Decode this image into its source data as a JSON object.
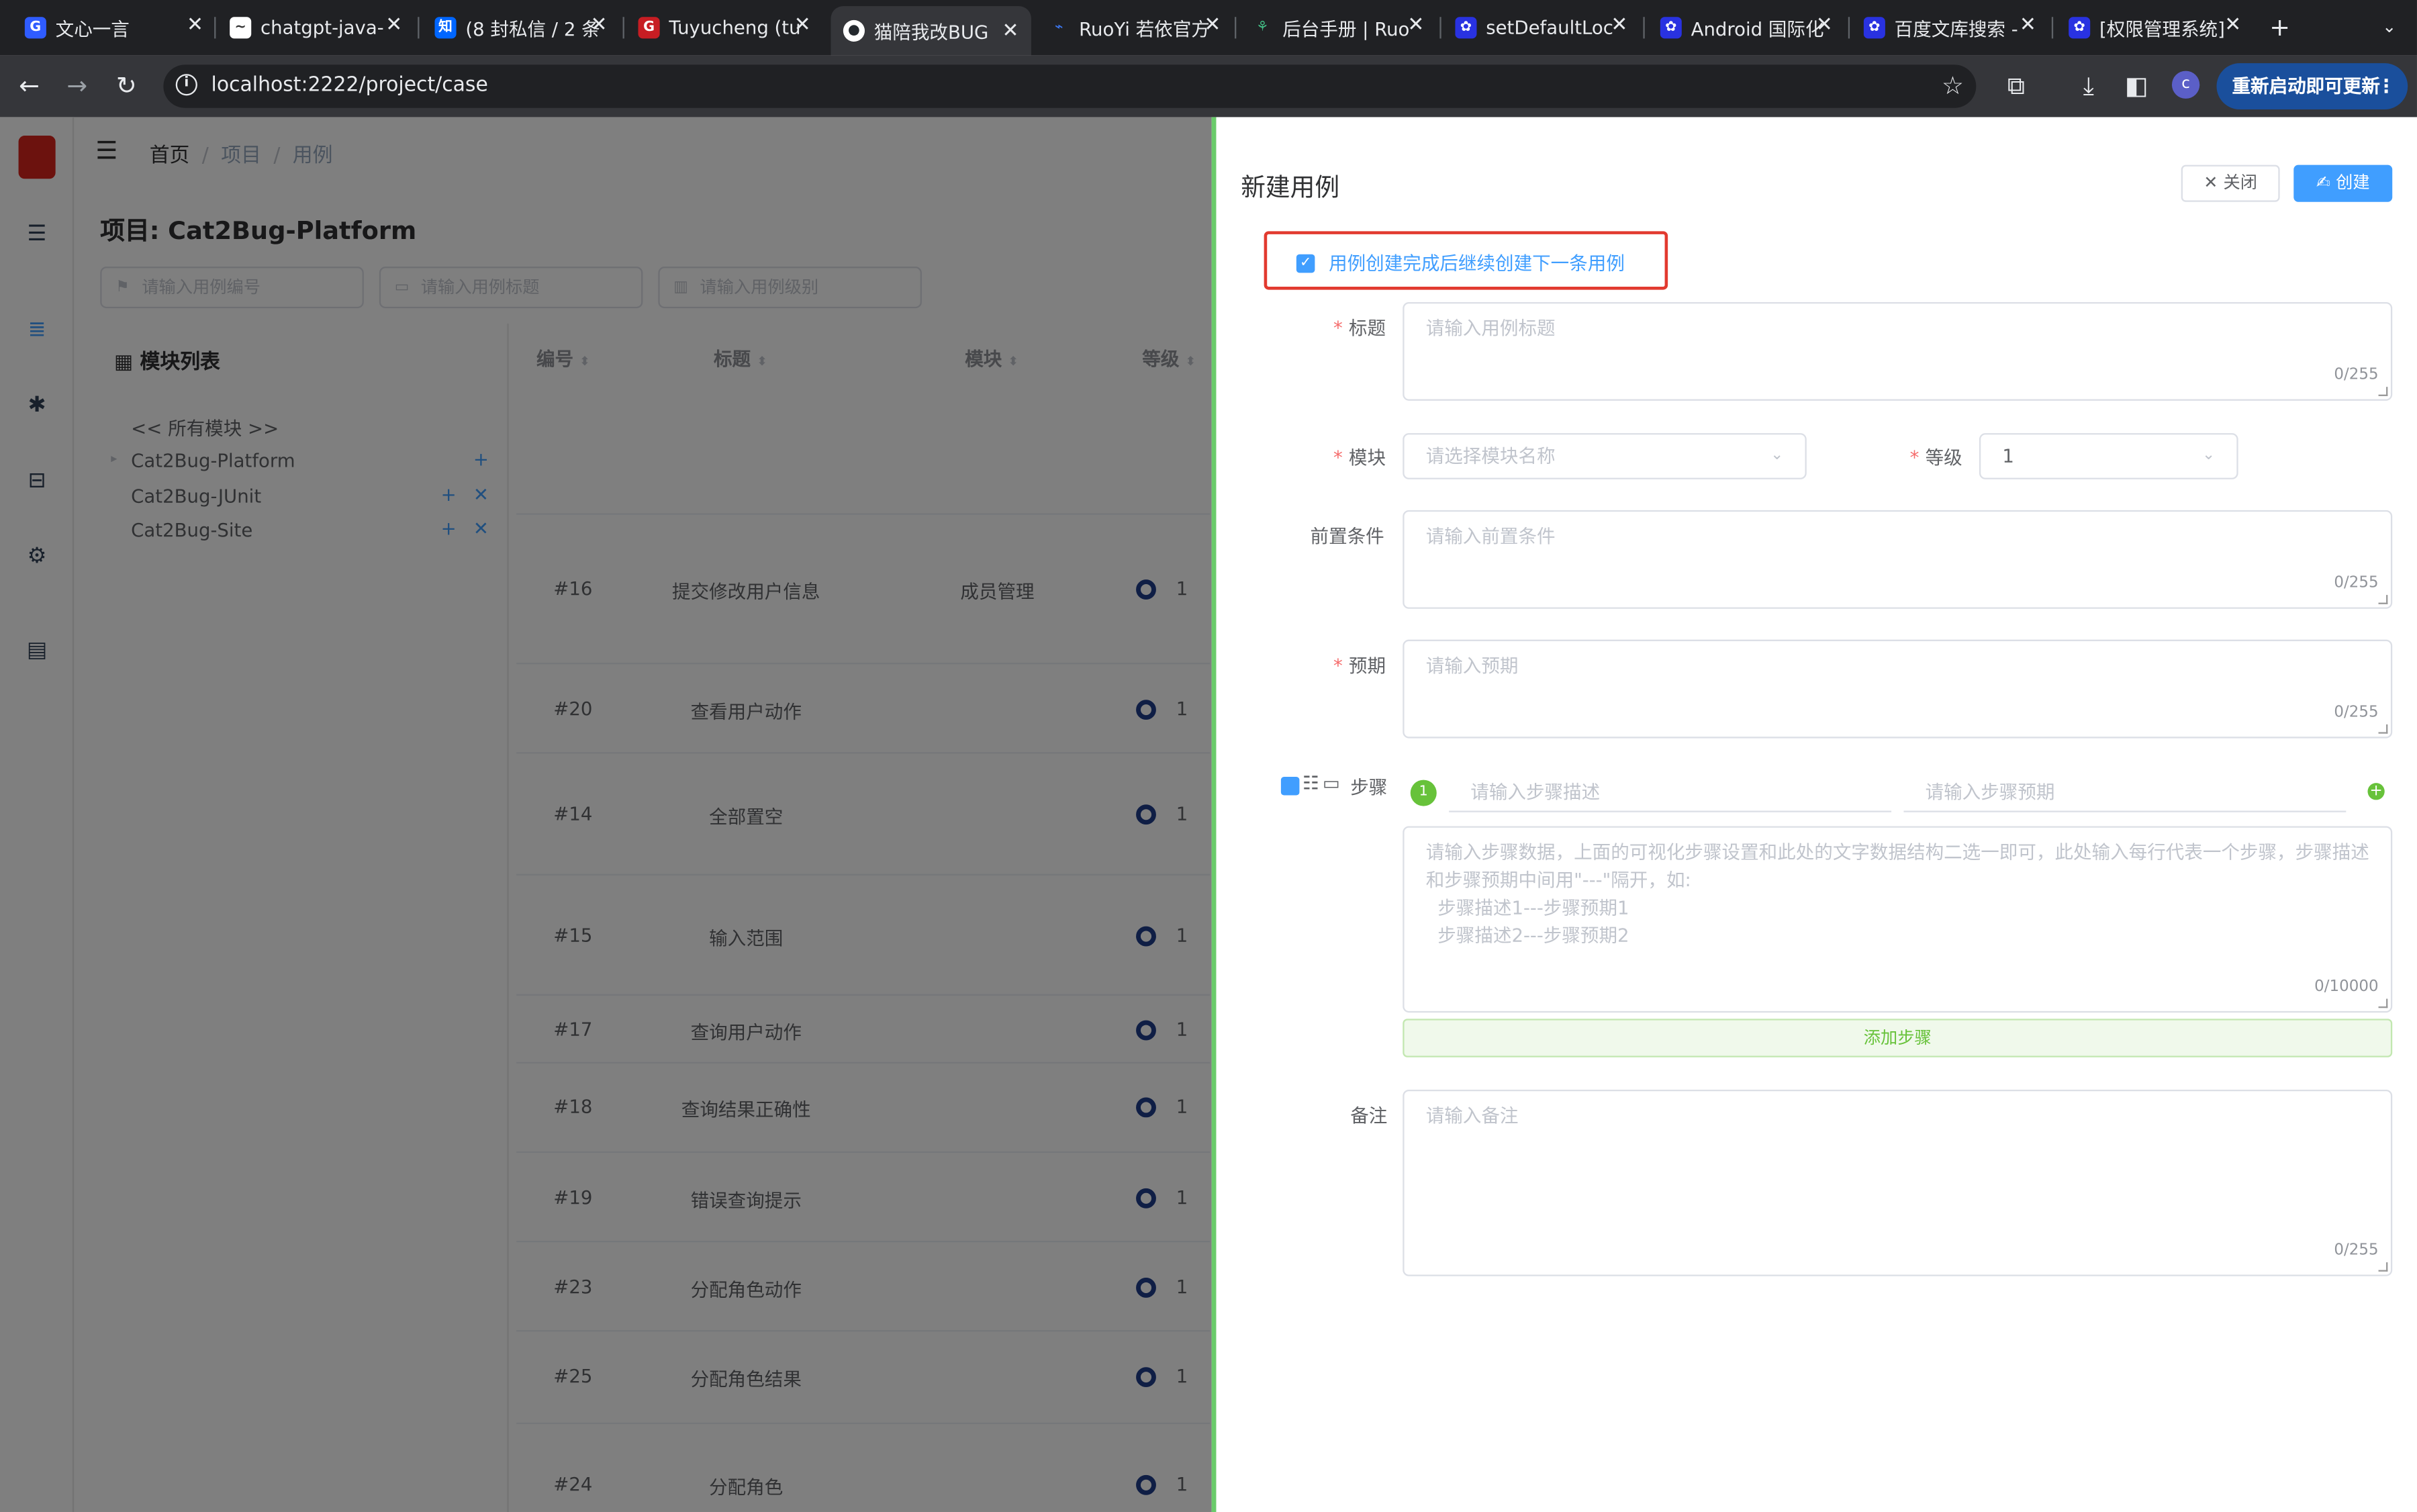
{
  "browser": {
    "tabs": [
      {
        "title": "文心一言",
        "icon": "wenxin-icon",
        "color": "#2f5cff"
      },
      {
        "title": "chatgpt-java-",
        "icon": "chatgpt-icon",
        "color": "#ffffff"
      },
      {
        "title": "(8 封私信 / 2 条",
        "icon": "zhihu-icon",
        "color": "#0066ff"
      },
      {
        "title": "Tuyucheng (tu",
        "icon": "gitee-icon",
        "color": "#c71d23"
      },
      {
        "title": "猫陪我改BUG",
        "icon": "github-icon",
        "color": "#ffffff"
      },
      {
        "title": "RuoYi 若依官方",
        "icon": "ruoyi-icon",
        "color": "#3c77f0"
      },
      {
        "title": "后台手册 | Ruo",
        "icon": "leaf-icon",
        "color": "#42b983"
      },
      {
        "title": "setDefaultLoc",
        "icon": "baidu-icon",
        "color": "#2932e1"
      },
      {
        "title": "Android 国际化",
        "icon": "baidu-icon",
        "color": "#2932e1"
      },
      {
        "title": "百度文库搜索 -",
        "icon": "baidu-icon",
        "color": "#2932e1"
      },
      {
        "title": "[权限管理系统]",
        "icon": "baidu-icon",
        "color": "#2932e1"
      }
    ],
    "url": "localhost:2222/project/case",
    "update_button": "重新启动即可更新",
    "profile_initial": "c"
  },
  "breadcrumb": [
    "首页",
    "项目",
    "用例"
  ],
  "page_title": "项目: Cat2Bug-Platform",
  "filters": {
    "case_no_placeholder": "请输入用例编号",
    "case_title_placeholder": "请输入用例标题",
    "case_level_placeholder": "请输入用例级别"
  },
  "modules": {
    "title": "模块列表",
    "items": [
      "<< 所有模块 >>",
      "Cat2Bug-Platform",
      "Cat2Bug-JUnit",
      "Cat2Bug-Site"
    ]
  },
  "table": {
    "headers": [
      "编号",
      "标题",
      "模块",
      "等级"
    ],
    "rows": [
      {
        "no": "#16",
        "title": "提交修改用户信息",
        "module": "成员管理",
        "level": "1"
      },
      {
        "no": "#20",
        "title": "查看用户动作",
        "module": "",
        "level": "1"
      },
      {
        "no": "#14",
        "title": "全部置空",
        "module": "",
        "level": "1"
      },
      {
        "no": "#15",
        "title": "输入范围",
        "module": "",
        "level": "1"
      },
      {
        "no": "#17",
        "title": "查询用户动作",
        "module": "",
        "level": "1"
      },
      {
        "no": "#18",
        "title": "查询结果正确性",
        "module": "",
        "level": "1"
      },
      {
        "no": "#19",
        "title": "错误查询提示",
        "module": "",
        "level": "1"
      },
      {
        "no": "#23",
        "title": "分配角色动作",
        "module": "",
        "level": "1"
      },
      {
        "no": "#25",
        "title": "分配角色结果",
        "module": "",
        "level": "1"
      },
      {
        "no": "#24",
        "title": "分配角色",
        "module": "",
        "level": "1"
      }
    ]
  },
  "drawer": {
    "title": "新建用例",
    "close_button": "关闭",
    "create_button": "创建",
    "continue_checkbox": {
      "label": "用例创建完成后继续创建下一条用例",
      "checked": true
    },
    "fields": {
      "title": {
        "label": "标题",
        "placeholder": "请输入用例标题",
        "counter": "0/255"
      },
      "module": {
        "label": "模块",
        "placeholder": "请选择模块名称"
      },
      "level": {
        "label": "等级",
        "value": "1"
      },
      "precondition": {
        "label": "前置条件",
        "placeholder": "请输入前置条件",
        "counter": "0/255"
      },
      "expected": {
        "label": "预期",
        "placeholder": "请输入预期",
        "counter": "0/255"
      },
      "steps": {
        "label": "步骤",
        "step_number": "1",
        "desc_placeholder": "请输入步骤描述",
        "expect_placeholder": "请输入步骤预期",
        "bulk_placeholder": "请输入步骤数据，上面的可视化步骤设置和此处的文字数据结构二选一即可，此处输入每行代表一个步骤，步骤描述和步骤预期中间用\"---\"隔开，如:\n  步骤描述1---步骤预期1\n  步骤描述2---步骤预期2",
        "counter": "0/10000",
        "add_button": "添加步骤"
      },
      "remark": {
        "label": "备注",
        "placeholder": "请输入备注",
        "counter": "0/255"
      }
    }
  },
  "colors": {
    "accent": "#409eff",
    "required": "#f56c6c",
    "highlight_border": "#e23a2f",
    "success": "#67c23a"
  }
}
